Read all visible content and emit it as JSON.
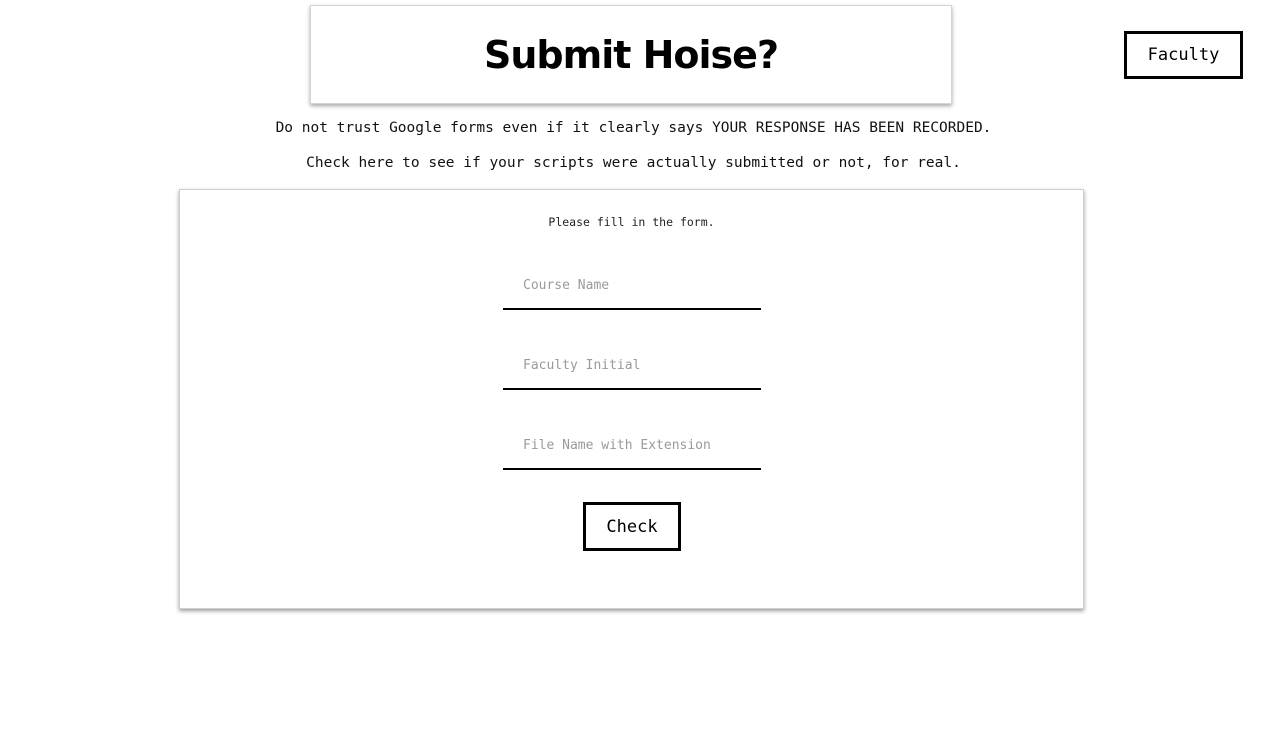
{
  "header": {
    "title": "Submit Hoise?"
  },
  "nav": {
    "faculty_label": "Faculty"
  },
  "notices": {
    "line1": "Do not trust Google forms even if it clearly says YOUR RESPONSE HAS BEEN RECORDED.",
    "line2": "Check here to see if your scripts were actually submitted or not, for real."
  },
  "form": {
    "instruction": "Please fill in the form.",
    "course_name": {
      "value": "",
      "placeholder": "Course Name"
    },
    "faculty_initial": {
      "value": "",
      "placeholder": "Faculty Initial"
    },
    "file_name": {
      "value": "",
      "placeholder": "File Name with Extension"
    },
    "check_label": "Check"
  }
}
